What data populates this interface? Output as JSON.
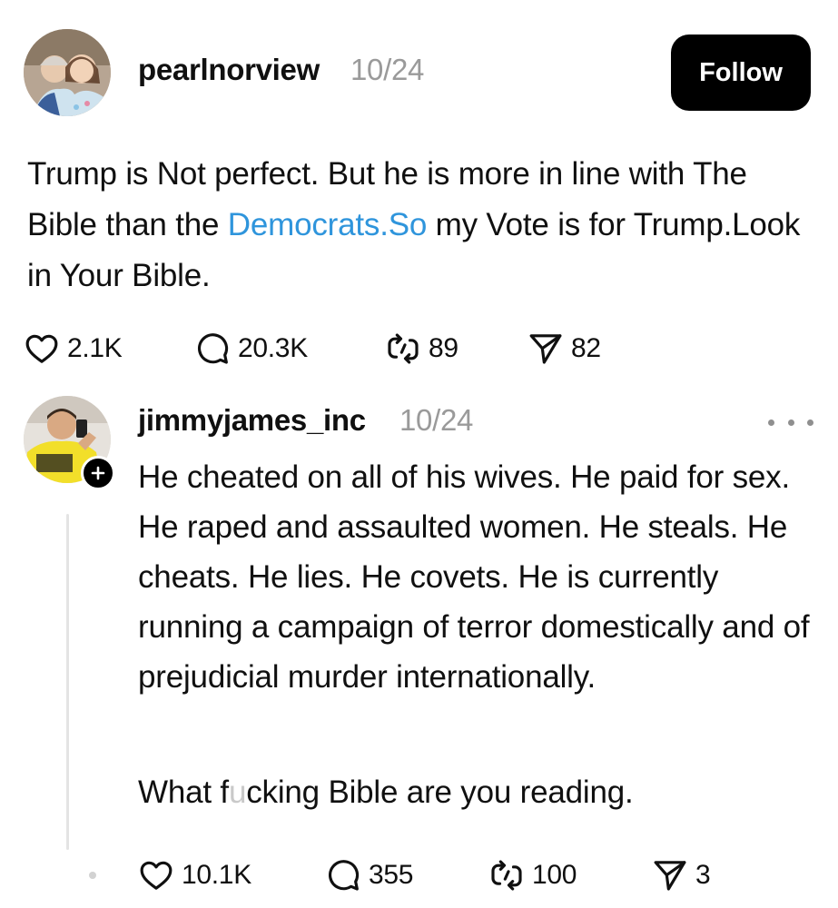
{
  "post": {
    "username": "pearlnorview",
    "date": "10/24",
    "follow_label": "Follow",
    "text_before_link": "Trump is Not perfect. But he is more in line with The Bible than the ",
    "link_text": "Democrats.So",
    "text_after_link": " my Vote is for Trump.Look in Your Bible.",
    "likes": "2.1K",
    "replies": "20.3K",
    "reposts": "89",
    "shares": "82"
  },
  "reply": {
    "username": "jimmyjames_inc",
    "date": "10/24",
    "text": "He cheated on all of his wives. He paid for sex. He raped and assaulted women. He steals. He cheats. He lies. He covets. He is currently running a campaign of terror domestically and of prejudicial murder internationally.",
    "text2_before": "What f",
    "text2_censored": "u",
    "text2_after": "cking Bible are you reading.",
    "likes": "10.1K",
    "replies": "355",
    "reposts": "100",
    "shares": "3"
  },
  "colors": {
    "link": "#2f95dc",
    "muted": "#9a9a9a",
    "text": "#101010",
    "follow_bg": "#000000"
  },
  "icons": [
    "heart-icon",
    "comment-icon",
    "repost-icon",
    "share-icon",
    "more-icon",
    "plus-icon"
  ]
}
